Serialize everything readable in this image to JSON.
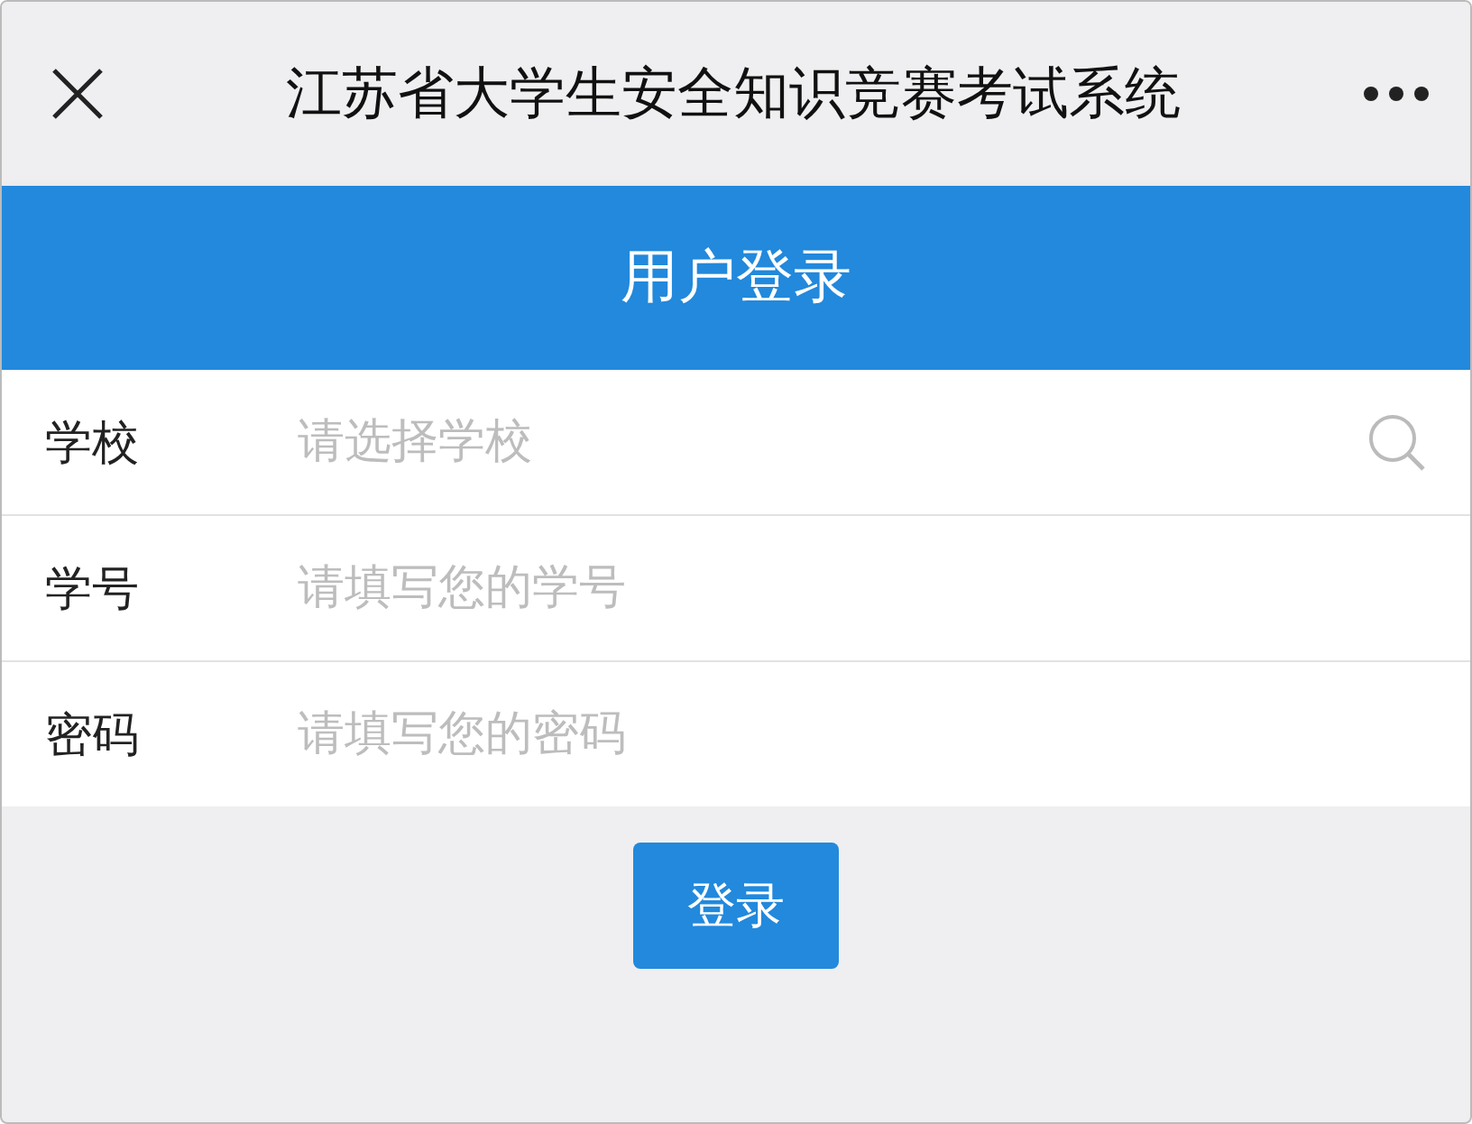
{
  "top_bar": {
    "title": "江苏省大学生安全知识竞赛考试系统"
  },
  "header": {
    "title": "用户登录"
  },
  "fields": [
    {
      "label": "学校",
      "placeholder": "请选择学校",
      "kind": "search"
    },
    {
      "label": "学号",
      "placeholder": "请填写您的学号",
      "kind": "text"
    },
    {
      "label": "密码",
      "placeholder": "请填写您的密码",
      "kind": "password"
    }
  ],
  "login_button": {
    "label": "登录"
  }
}
